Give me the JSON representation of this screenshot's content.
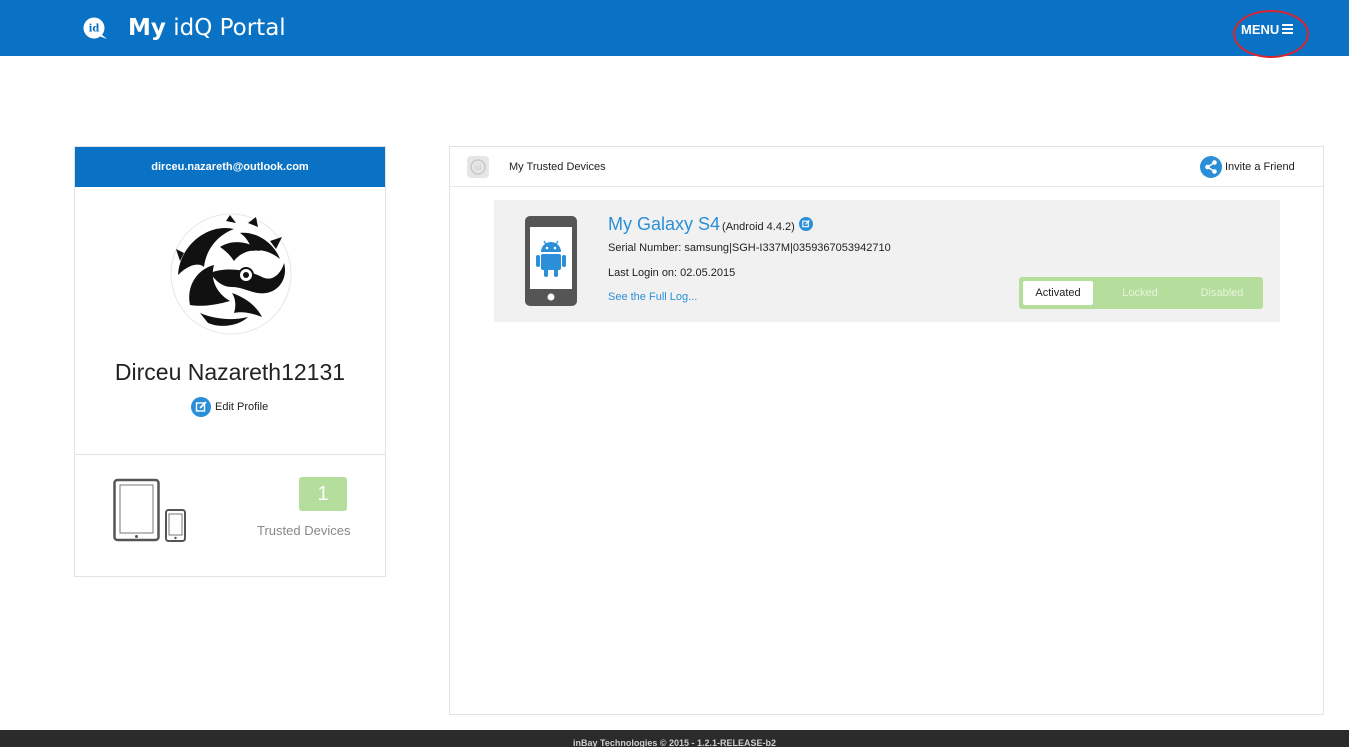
{
  "header": {
    "brand_bold": "My",
    "brand_rest": " idQ Portal",
    "menu_label": "MENU",
    "icons": {
      "logo": "idq-logo-icon",
      "menu": "hamburger-icon"
    },
    "colors": {
      "bar": "#0a72c4",
      "highlight_ring": "#d9232d"
    }
  },
  "profile": {
    "email": "dirceu.nazareth@outlook.com",
    "name": "Dirceu Nazareth12131",
    "edit_label": "Edit Profile",
    "trusted_count": "1",
    "trusted_label": "Trusted Devices",
    "icons": {
      "avatar": "tribal-dragon-avatar",
      "edit": "edit-icon",
      "devices": "tablet-phone-icon"
    }
  },
  "devices_panel": {
    "title": "My Trusted Devices",
    "invite_label": "Invite a Friend",
    "icons": {
      "panel_logo": "idq-logo-icon",
      "invite": "share-icon"
    },
    "devices": [
      {
        "name": "My Galaxy S4",
        "os": "(Android 4.4.2)",
        "serial": "Serial Number: samsung|SGH-I337M|0359367053942710",
        "last_login": "Last Login on: 02.05.2015",
        "log_link": "See the Full Log...",
        "states": [
          "Activated",
          "Locked",
          "Disabled"
        ],
        "selected_state": "Activated",
        "icon": "android-phone-icon"
      }
    ]
  },
  "footer": {
    "text": "inBay Technologies © 2015 - 1.2.1-RELEASE-b2"
  },
  "colors": {
    "accent": "#2a8fd8",
    "toggle_green": "#b5dd9c",
    "footer_bg": "#2b2b2b"
  }
}
